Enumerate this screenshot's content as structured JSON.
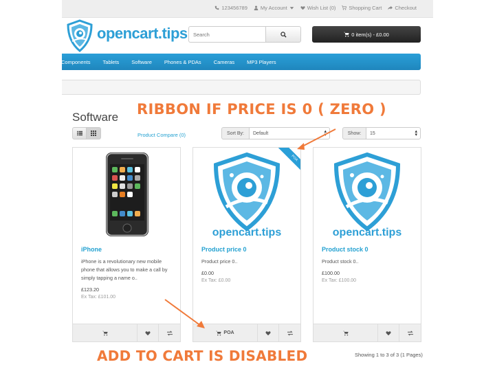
{
  "top_bar": {
    "phone": "123456789",
    "my_account": "My Account",
    "wish_list": "Wish List (0)",
    "shopping_cart": "Shopping Cart",
    "checkout": "Checkout"
  },
  "logo": {
    "text": "opencart.tips"
  },
  "search": {
    "placeholder": "Search"
  },
  "cart": {
    "label": "0 item(s) - £0.00"
  },
  "menu": {
    "items": [
      "Components",
      "Tablets",
      "Software",
      "Phones & PDAs",
      "Cameras",
      "MP3 Players"
    ]
  },
  "page": {
    "title": "Software"
  },
  "toolbar": {
    "compare": "Product Compare (0)",
    "sort_label": "Sort By:",
    "sort_value": "Default",
    "show_label": "Show:",
    "show_value": "15"
  },
  "products": [
    {
      "name": "iPhone",
      "description": "iPhone is a revolutionary new mobile phone that allows you to make a call by simply tapping a name o..",
      "price": "£123.20",
      "ex_tax": "Ex Tax: £101.00",
      "cart_label": ""
    },
    {
      "name": "Product price 0",
      "description": "Product price 0..",
      "price": "£0.00",
      "ex_tax": "Ex Tax: £0.00",
      "cart_label": "POA",
      "ribbon": "POA",
      "image_caption": "opencart.tips"
    },
    {
      "name": "Product stock 0",
      "description": "Product stock 0..",
      "price": "£100.00",
      "ex_tax": "Ex Tax: £100.00",
      "cart_label": "",
      "image_caption": "opencart.tips"
    }
  ],
  "annotations": {
    "top": "RIBBON IF PRICE IS 0 ( ZERO )",
    "bottom": "ADD TO CART IS DISABLED"
  },
  "pagination": {
    "text": "Showing 1 to 3 of 3 (1 Pages)"
  },
  "colors": {
    "brand_blue": "#2a9fd8",
    "annotation_orange": "#f07a3a",
    "link_blue": "#23a1d1"
  }
}
